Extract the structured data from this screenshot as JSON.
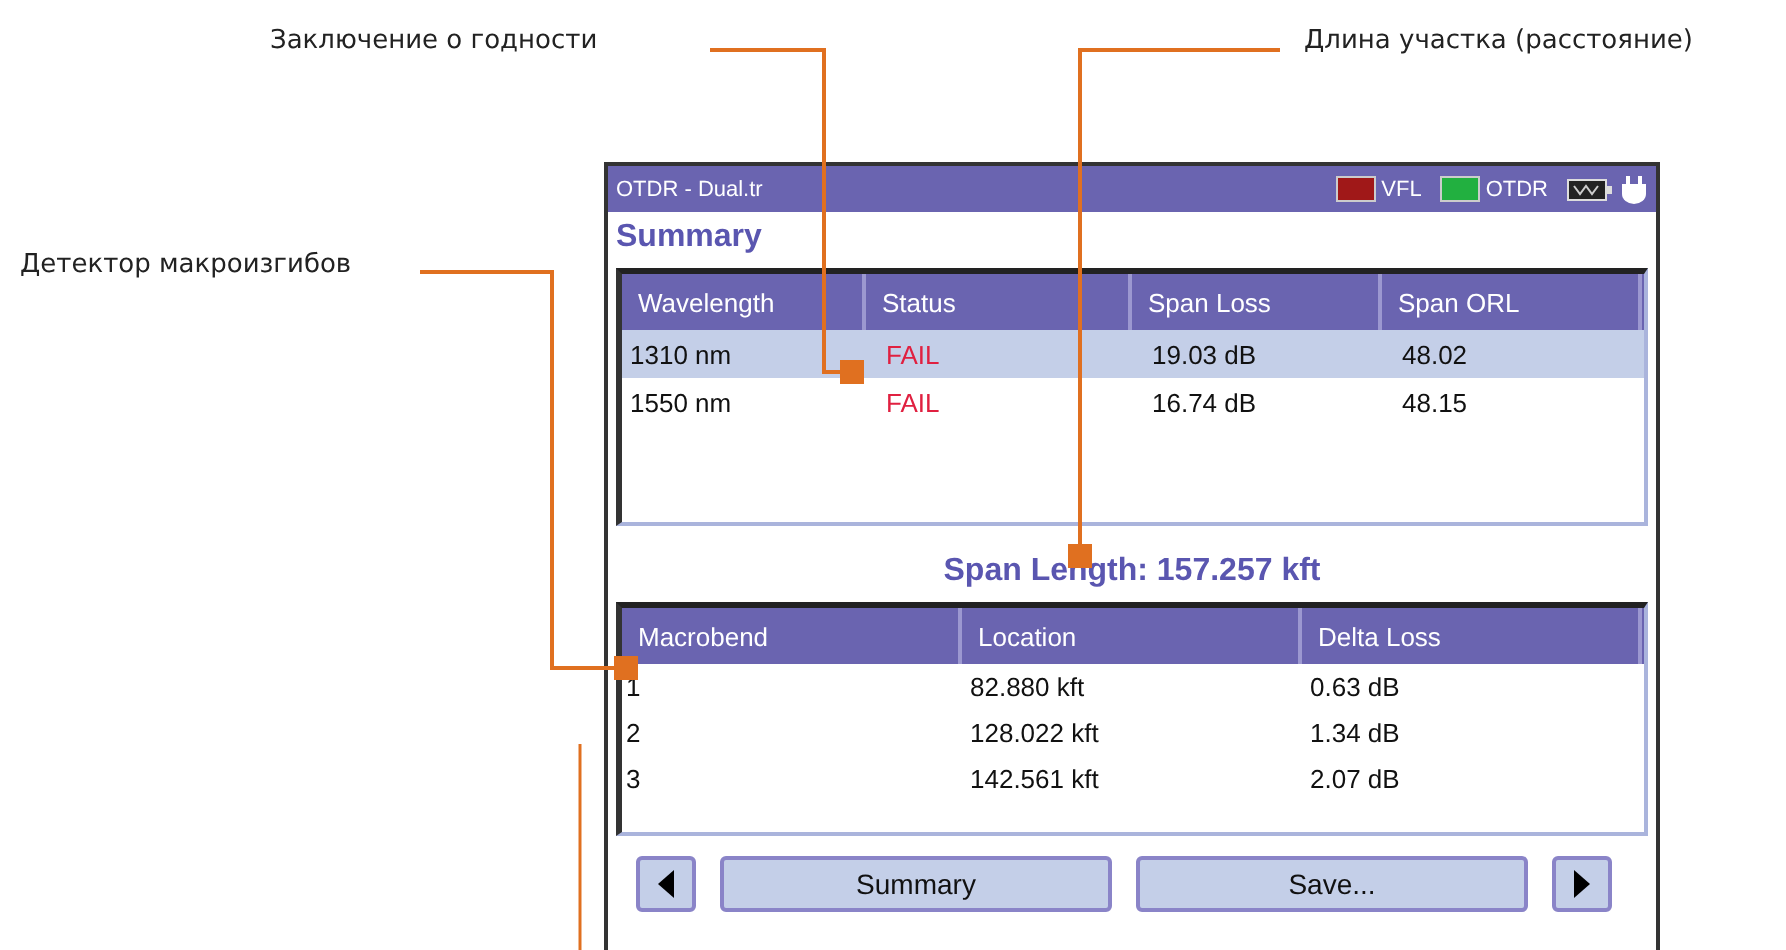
{
  "callouts": [
    "Заключение о годности",
    "Длина участка (расстояние)",
    "Детектор макроизгибов"
  ],
  "window": {
    "title": "OTDR - Dual.tr",
    "indicators": [
      {
        "label": "VFL",
        "color": "#a01818"
      },
      {
        "label": "OTDR",
        "color": "#22b040"
      }
    ]
  },
  "heading": "Summary",
  "summary_table": {
    "columns": [
      "Wavelength",
      "Status",
      "Span Loss",
      "Span ORL"
    ],
    "rows": [
      {
        "cells": [
          "1310 nm",
          "FAIL",
          "19.03 dB",
          "48.02"
        ],
        "selected": true
      },
      {
        "cells": [
          "1550 nm",
          "FAIL",
          "16.74 dB",
          "48.15"
        ],
        "selected": false
      }
    ]
  },
  "span_length": "Span Length: 157.257 kft",
  "macrobend_table": {
    "columns": [
      "Macrobend",
      "Location",
      "Delta Loss"
    ],
    "rows": [
      [
        "1",
        "82.880 kft",
        "0.63 dB"
      ],
      [
        "2",
        "128.022 kft",
        "1.34 dB"
      ],
      [
        "3",
        "142.561 kft",
        "2.07 dB"
      ]
    ]
  },
  "buttons": [
    "Summary",
    "Save..."
  ]
}
